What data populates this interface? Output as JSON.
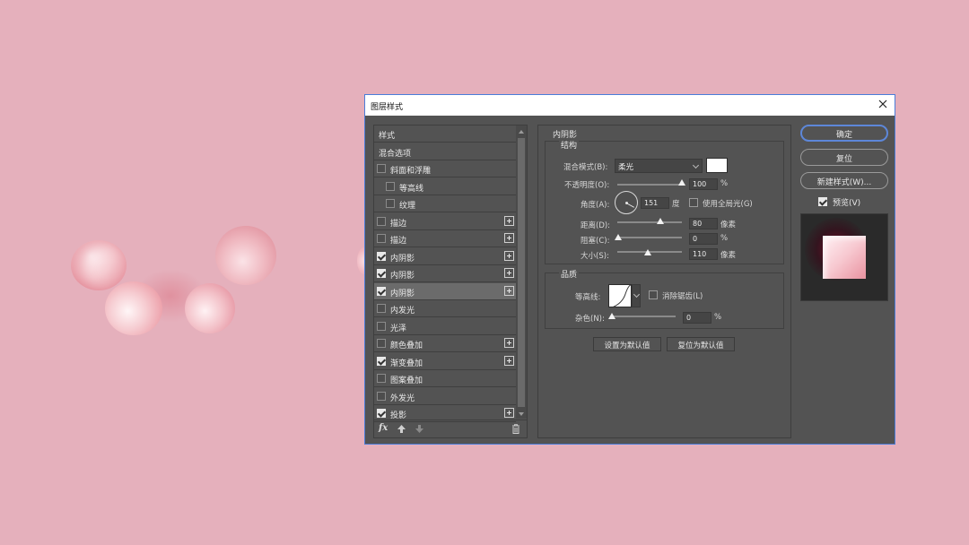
{
  "dialog": {
    "title": "图层样式"
  },
  "style_list": {
    "header": "样式",
    "items": [
      {
        "label": "混合选项",
        "checkbox": false,
        "checked": false,
        "plus": false,
        "indent": 0,
        "selected": false
      },
      {
        "label": "斜面和浮雕",
        "checkbox": true,
        "checked": false,
        "plus": false,
        "indent": 0,
        "selected": false
      },
      {
        "label": "等高线",
        "checkbox": true,
        "checked": false,
        "plus": false,
        "indent": 1,
        "selected": false
      },
      {
        "label": "纹理",
        "checkbox": true,
        "checked": false,
        "plus": false,
        "indent": 1,
        "selected": false
      },
      {
        "label": "描边",
        "checkbox": true,
        "checked": false,
        "plus": true,
        "indent": 0,
        "selected": false
      },
      {
        "label": "描边",
        "checkbox": true,
        "checked": false,
        "plus": true,
        "indent": 0,
        "selected": false
      },
      {
        "label": "内阴影",
        "checkbox": true,
        "checked": true,
        "plus": true,
        "indent": 0,
        "selected": false
      },
      {
        "label": "内阴影",
        "checkbox": true,
        "checked": true,
        "plus": true,
        "indent": 0,
        "selected": false
      },
      {
        "label": "内阴影",
        "checkbox": true,
        "checked": true,
        "plus": true,
        "indent": 0,
        "selected": true
      },
      {
        "label": "内发光",
        "checkbox": true,
        "checked": false,
        "plus": false,
        "indent": 0,
        "selected": false
      },
      {
        "label": "光泽",
        "checkbox": true,
        "checked": false,
        "plus": false,
        "indent": 0,
        "selected": false
      },
      {
        "label": "颜色叠加",
        "checkbox": true,
        "checked": false,
        "plus": true,
        "indent": 0,
        "selected": false
      },
      {
        "label": "渐变叠加",
        "checkbox": true,
        "checked": true,
        "plus": true,
        "indent": 0,
        "selected": false
      },
      {
        "label": "图案叠加",
        "checkbox": true,
        "checked": false,
        "plus": false,
        "indent": 0,
        "selected": false
      },
      {
        "label": "外发光",
        "checkbox": true,
        "checked": false,
        "plus": false,
        "indent": 0,
        "selected": false
      },
      {
        "label": "投影",
        "checkbox": true,
        "checked": true,
        "plus": true,
        "indent": 0,
        "selected": false
      }
    ],
    "footer": {
      "fx_label": "fx"
    }
  },
  "inner_shadow": {
    "section_title": "内阴影",
    "structure": {
      "title": "结构",
      "blend_mode_label": "混合模式(B):",
      "blend_mode_value": "柔光",
      "shadow_color": "#ffffff",
      "opacity_label": "不透明度(O):",
      "opacity_value": "100",
      "opacity_unit": "%",
      "opacity_fraction": 1.0,
      "angle_label": "角度(A):",
      "angle_value": "151",
      "angle_unit": "度",
      "global_light_label": "使用全局光(G)",
      "distance_label": "距离(D):",
      "distance_value": "80",
      "distance_unit": "像素",
      "choke_label": "阻塞(C):",
      "choke_value": "0",
      "choke_unit": "%",
      "size_label": "大小(S):",
      "size_value": "110",
      "size_unit": "像素"
    },
    "quality": {
      "title": "品质",
      "contour_label": "等高线:",
      "antialias_label": "消除锯齿(L)",
      "noise_label": "杂色(N):",
      "noise_value": "0",
      "noise_unit": "%"
    },
    "make_default_label": "设置为默认值",
    "reset_default_label": "复位为默认值"
  },
  "actions": {
    "ok_label": "确定",
    "reset_label": "复位",
    "new_style_label": "新建样式(W)...",
    "preview_label": "预览(V)"
  },
  "colors": {
    "canvas_bg": "#e5b0bc",
    "dialog_bg": "#535353",
    "accent": "#5d87d9"
  }
}
